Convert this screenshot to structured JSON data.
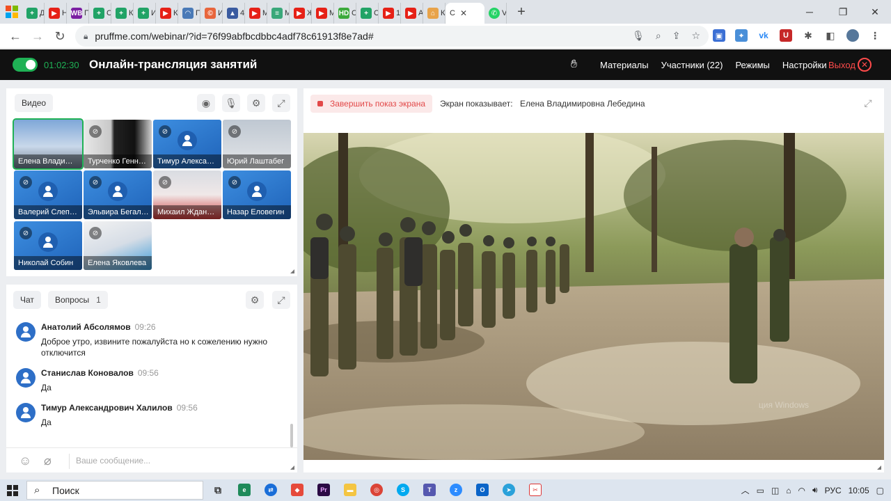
{
  "browser": {
    "tabs": [
      {
        "label": "Д",
        "color": "#21a366",
        "glyph": "+"
      },
      {
        "label": "Н",
        "color": "#e62117",
        "glyph": "▶"
      },
      {
        "label": "П",
        "color": "#7b1fa2",
        "glyph": "WB"
      },
      {
        "label": "С",
        "color": "#21a366",
        "glyph": "+"
      },
      {
        "label": "К",
        "color": "#21a366",
        "glyph": "+"
      },
      {
        "label": "И",
        "color": "#21a366",
        "glyph": "+"
      },
      {
        "label": "К",
        "color": "#e62117",
        "glyph": "▶"
      },
      {
        "label": "П",
        "color": "#4a7ab7",
        "glyph": "◠"
      },
      {
        "label": "И",
        "color": "#e8663d",
        "glyph": "©"
      },
      {
        "label": "4",
        "color": "#3a5ba0",
        "glyph": "▲"
      },
      {
        "label": "M",
        "color": "#e62117",
        "glyph": "▶"
      },
      {
        "label": "M",
        "color": "#3aa87a",
        "glyph": "≡"
      },
      {
        "label": "Ж",
        "color": "#e62117",
        "glyph": "▶"
      },
      {
        "label": "M",
        "color": "#e62117",
        "glyph": "▶"
      },
      {
        "label": "С",
        "color": "#3caa3c",
        "glyph": "HD"
      },
      {
        "label": "С",
        "color": "#21a366",
        "glyph": "+"
      },
      {
        "label": "1",
        "color": "#e62117",
        "glyph": "▶"
      },
      {
        "label": "А",
        "color": "#e62117",
        "glyph": "▶"
      },
      {
        "label": "К",
        "color": "#e8a34a",
        "glyph": "⌂"
      }
    ],
    "active_tab_label": "С",
    "whatsapp_tab_label": "V",
    "url": "pruffme.com/webinar/?id=76f99abfbcdbbc4adf78c61913f8e7ad#"
  },
  "app": {
    "timer": "01:02:30",
    "title": "Онлайн-трансляция занятий",
    "nav": {
      "materials": "Материалы",
      "participants": "Участники (22)",
      "modes": "Режимы",
      "settings": "Настройки",
      "exit": "Выход"
    }
  },
  "video_panel": {
    "label": "Видео",
    "participants": [
      {
        "name": "Елена Влади…",
        "style": "photo1",
        "muted": false,
        "active": true
      },
      {
        "name": "Турченко Генн…",
        "style": "photo2",
        "muted": true,
        "active": false
      },
      {
        "name": "Тимур Алекса…",
        "style": "blue",
        "muted": true,
        "active": false
      },
      {
        "name": "Юрий Лаштабег",
        "style": "photo3",
        "muted": true,
        "active": false
      },
      {
        "name": "Валерий Слеп…",
        "style": "blue",
        "muted": true,
        "active": false
      },
      {
        "name": "Эльвира Бегал…",
        "style": "blue",
        "muted": true,
        "active": false
      },
      {
        "name": "Михаил Ждан…",
        "style": "photo4",
        "muted": true,
        "active": false
      },
      {
        "name": "Назар Еловегин",
        "style": "blue",
        "muted": true,
        "active": false
      },
      {
        "name": "Николай Собин",
        "style": "blue",
        "muted": true,
        "active": false
      },
      {
        "name": "Елена Яковлева",
        "style": "photo5",
        "muted": true,
        "active": false
      }
    ]
  },
  "chat_panel": {
    "tab_chat": "Чат",
    "tab_questions": "Вопросы",
    "questions_count": "1",
    "messages": [
      {
        "author": "Анатолий Абсолямов",
        "time": "09:26",
        "text": "Доброе утро, извините пожалуйста но к сожелению нужно отключится"
      },
      {
        "author": "Станислав Коновалов",
        "time": "09:56",
        "text": "Да"
      },
      {
        "author": "Тимур Александрович Халилов",
        "time": "09:56",
        "text": "Да"
      }
    ],
    "input_placeholder": "Ваше сообщение..."
  },
  "screen_panel": {
    "stop_button": "Завершить показ экрана",
    "showing_label": "Экран показывает:",
    "presenter": "Елена Владимировна Лебедина",
    "watermark": "ция Windows"
  },
  "taskbar": {
    "search_label": "Поиск",
    "language": "РУС",
    "clock": "10:05"
  },
  "colors": {
    "accent_green": "#1fb155",
    "exit_red": "#ff4b4b",
    "header_bg": "#111111",
    "participant_blue": "#2e6fc7"
  }
}
